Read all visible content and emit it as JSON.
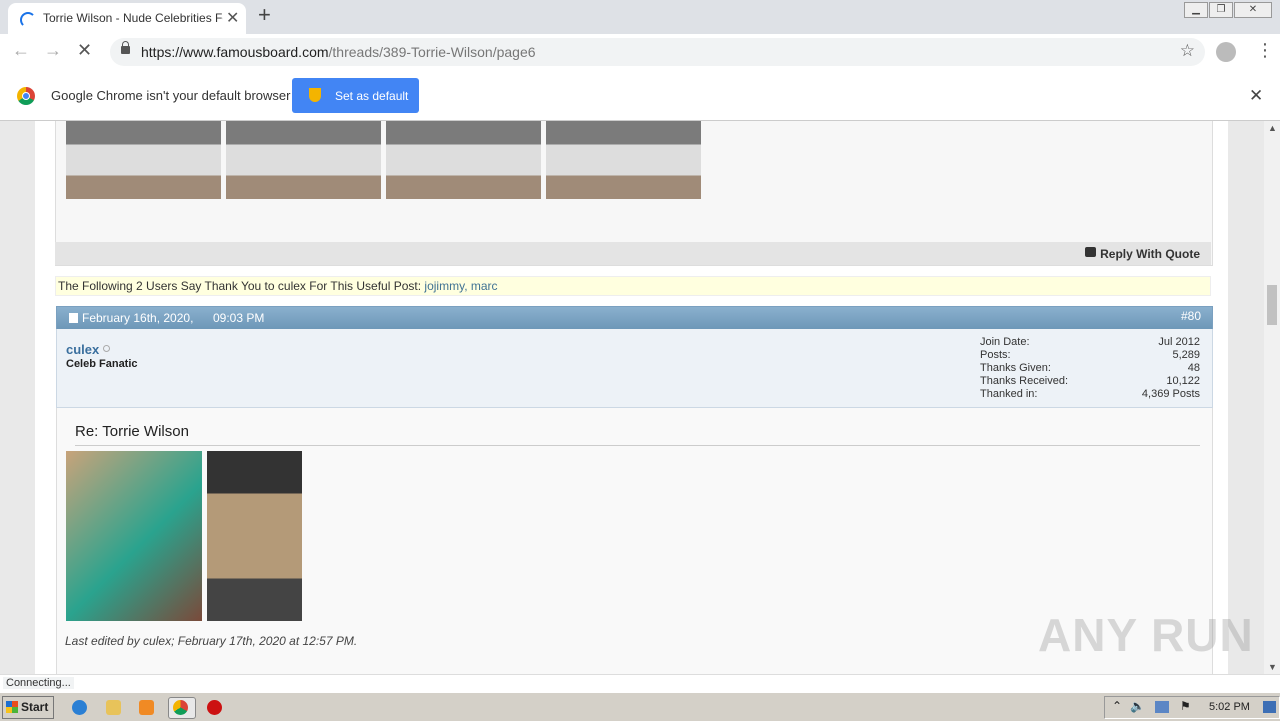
{
  "browser": {
    "tab_title": "Torrie Wilson - Nude Celebrities Forum",
    "new_tab": "+",
    "url_host": "https://www.famousboard.com",
    "url_path": "/threads/389-Torrie-Wilson/page6",
    "infobar_message": "Google Chrome isn't your default browser",
    "set_default_label": "Set as default",
    "status_text": "Connecting..."
  },
  "post_prev": {
    "reply_with_quote": "Reply With Quote",
    "thanks_text": "The Following 2 Users Say Thank You to culex For This Useful Post:",
    "thanks_users": "jojimmy, marc"
  },
  "post": {
    "date": "February 16th, 2020,",
    "time": "09:03 PM",
    "number": "#80",
    "username": "culex",
    "user_title": "Celeb Fanatic",
    "stats": [
      {
        "label": "Join Date:",
        "value": "Jul 2012"
      },
      {
        "label": "Posts:",
        "value": "5,289"
      },
      {
        "label": "Thanks Given:",
        "value": "48"
      },
      {
        "label": "Thanks Received:",
        "value": "10,122"
      },
      {
        "label": "Thanked in:",
        "value": "4,369 Posts"
      }
    ],
    "title": "Re: Torrie Wilson",
    "edited_note": "Last edited by culex; February 17th, 2020 at 12:57 PM."
  },
  "taskbar": {
    "start_label": "Start",
    "clock": "5:02 PM"
  },
  "watermark": "ANY RUN",
  "colors": {
    "post_header": "#7ea6c6",
    "thanks_bg": "#ffffdf",
    "chrome_button": "#4285f4"
  }
}
